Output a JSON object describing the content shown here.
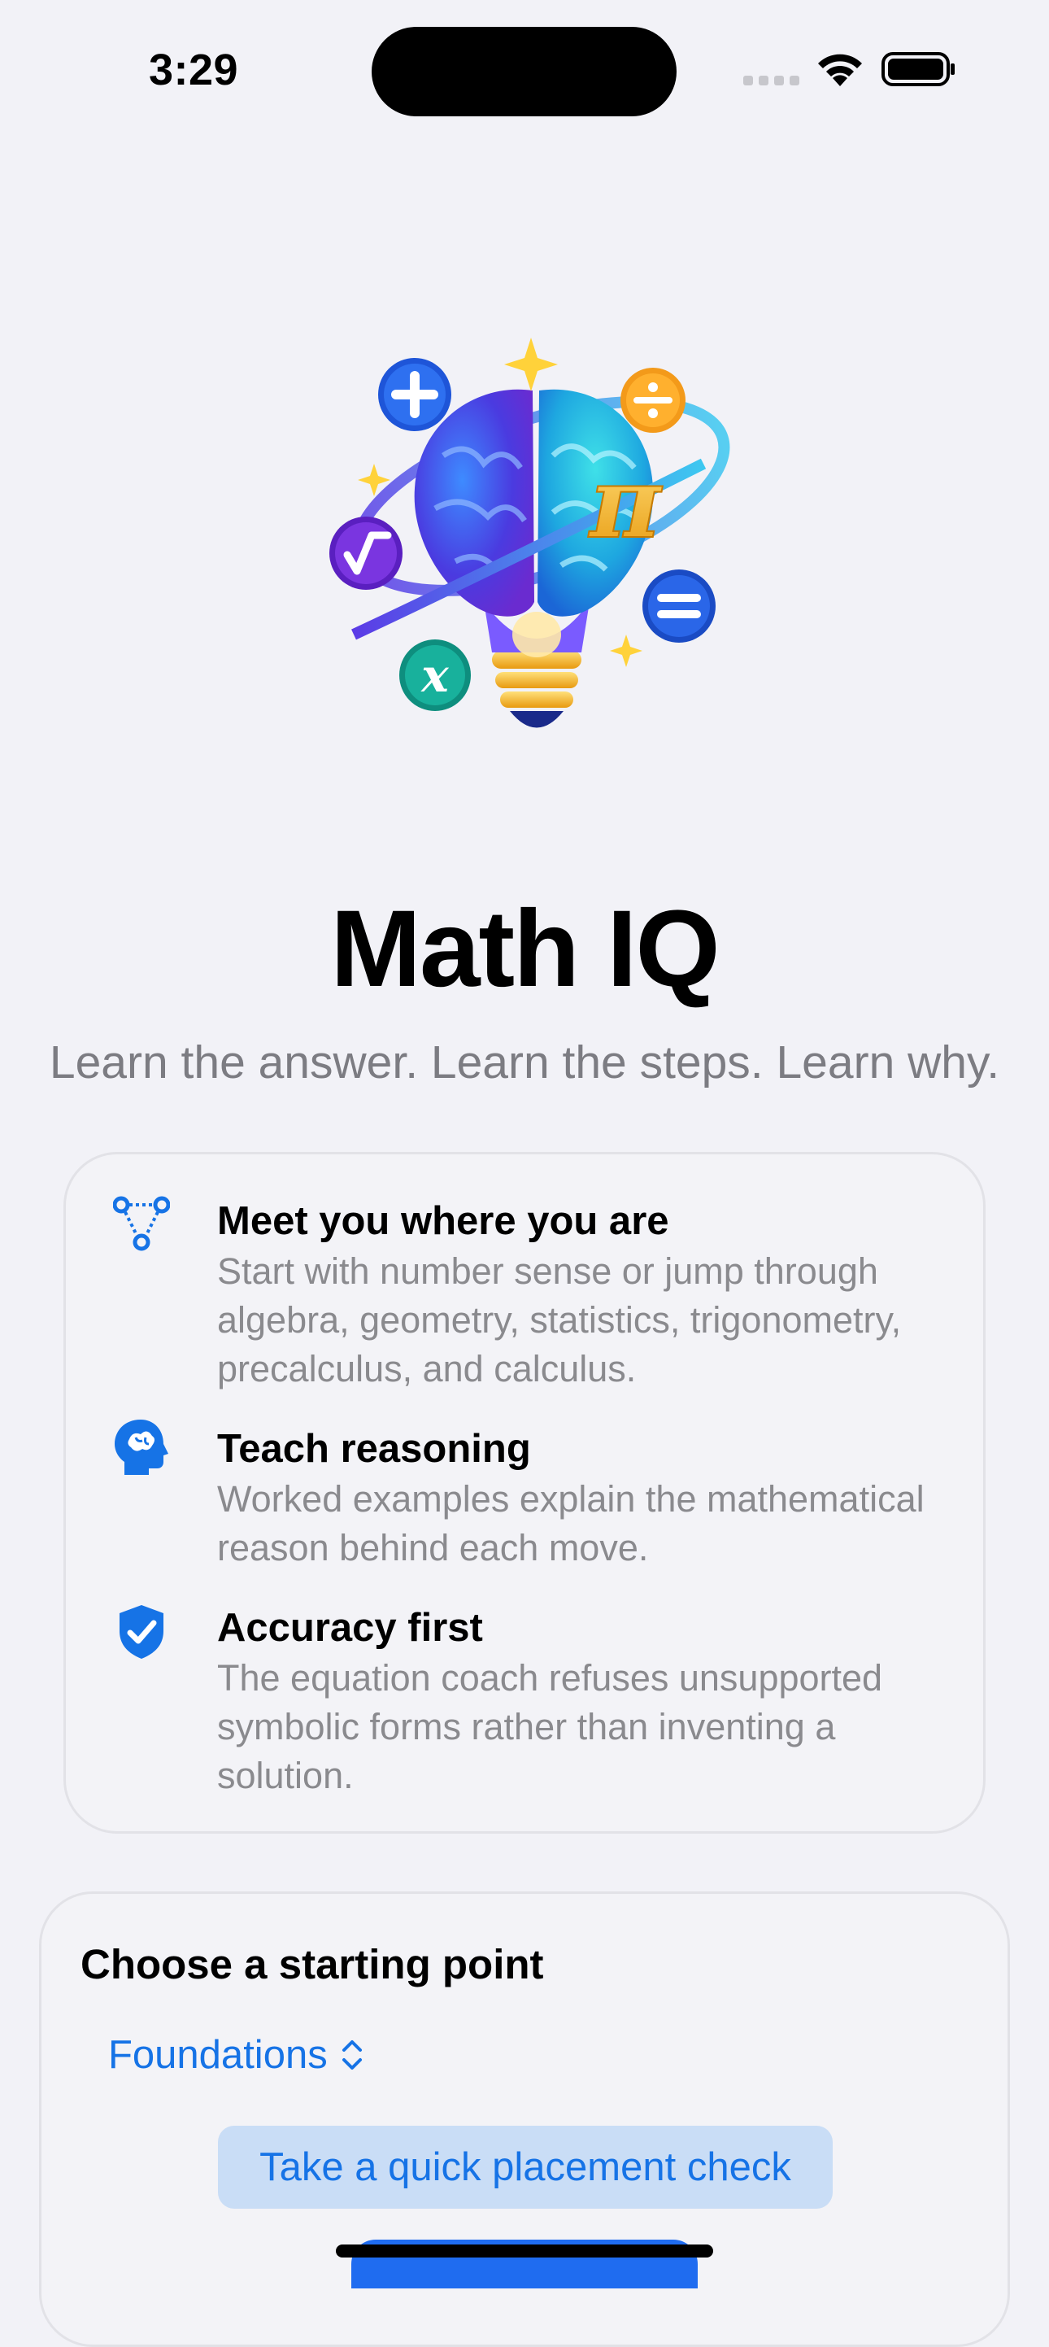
{
  "status_bar": {
    "time": "3:29",
    "icons": [
      "cellular-icon",
      "wifi-icon",
      "battery-icon"
    ]
  },
  "hero": {
    "icon": "brain-lightbulb-math-icon",
    "title": "Math IQ",
    "subtitle": "Learn the answer. Learn the steps. Learn why."
  },
  "features": [
    {
      "icon": "path-nodes-icon",
      "title": "Meet you where you are",
      "description": "Start with number sense or jump through algebra, geometry, statistics, trigonometry, precalculus, and calculus."
    },
    {
      "icon": "brain-head-icon",
      "title": "Teach reasoning",
      "description": "Worked examples explain the mathematical reason behind each move."
    },
    {
      "icon": "checkmark-shield-icon",
      "title": "Accuracy first",
      "description": "The equation coach refuses unsupported symbolic forms rather than inventing a solution."
    }
  ],
  "starting_point": {
    "title": "Choose a starting point",
    "selected_level": "Foundations",
    "placement_button": "Take a quick placement check"
  },
  "colors": {
    "background": "#F2F2F7",
    "accent": "#1673E6",
    "secondary_text": "#7C7C82"
  }
}
